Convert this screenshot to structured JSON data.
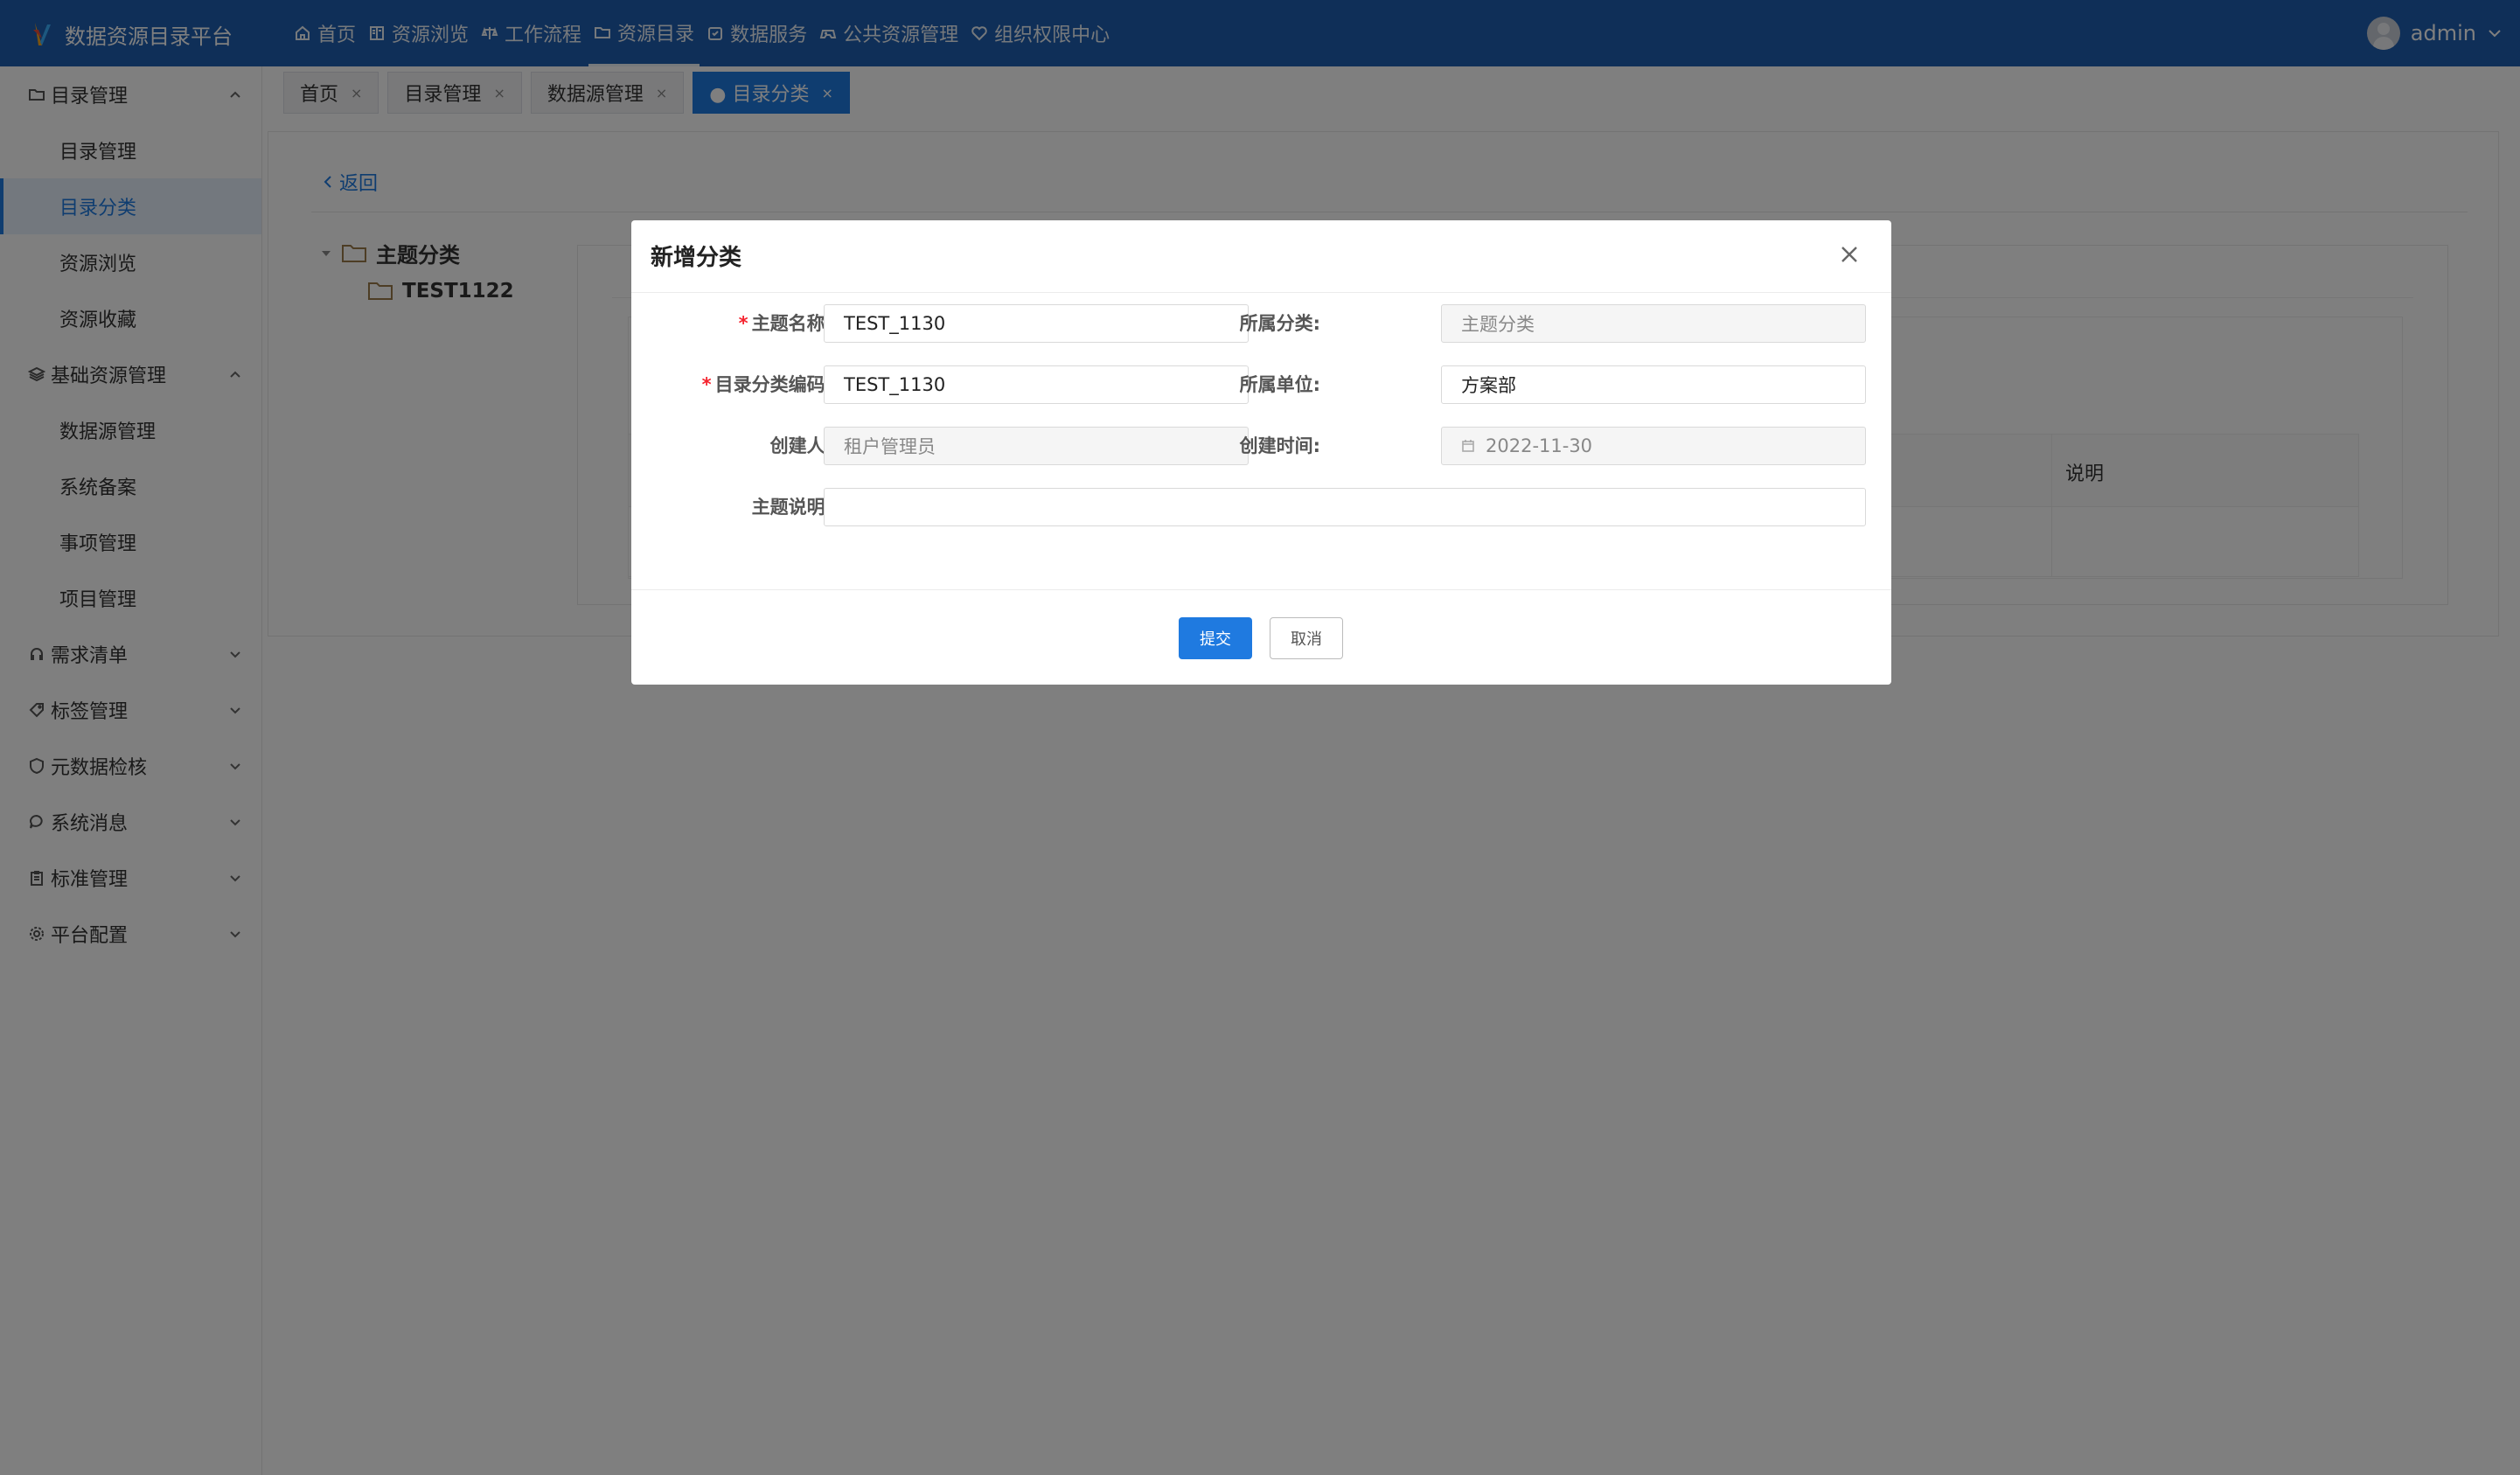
{
  "app": {
    "title": "数据资源目录平台"
  },
  "nav": [
    {
      "label": "首页",
      "icon": "home-icon"
    },
    {
      "label": "资源浏览",
      "icon": "book-icon"
    },
    {
      "label": "工作流程",
      "icon": "workflow-icon"
    },
    {
      "label": "资源目录",
      "icon": "folder-icon",
      "active": true
    },
    {
      "label": "数据服务",
      "icon": "service-icon"
    },
    {
      "label": "公共资源管理",
      "icon": "gamepad-icon"
    },
    {
      "label": "组织权限中心",
      "icon": "heart-icon"
    }
  ],
  "user": {
    "name": "admin"
  },
  "sidebar": {
    "group1": {
      "label": "目录管理",
      "items": [
        "目录管理",
        "目录分类",
        "资源浏览",
        "资源收藏"
      ],
      "active_item": "目录分类"
    },
    "group2": {
      "label": "基础资源管理",
      "items": [
        "数据源管理",
        "系统备案",
        "事项管理",
        "项目管理"
      ]
    },
    "collapsed": [
      "需求清单",
      "标签管理",
      "元数据检核",
      "系统消息",
      "标准管理",
      "平台配置"
    ]
  },
  "tabs": [
    {
      "label": "首页"
    },
    {
      "label": "目录管理"
    },
    {
      "label": "数据源管理"
    },
    {
      "label": "● 目录分类",
      "active": true
    }
  ],
  "tab_close": "×",
  "page": {
    "back_label": "返回",
    "tree_root": "主题分类",
    "tree_child": "TEST1122",
    "table_col_desc": "说明"
  },
  "modal": {
    "title": "新增分类",
    "fields": {
      "theme_name": {
        "label": "主题名称:",
        "value": "TEST_1130",
        "required": true
      },
      "category": {
        "label": "所属分类:",
        "value": "主题分类",
        "disabled": true
      },
      "code": {
        "label": "目录分类编码:",
        "value": "TEST_1130",
        "required": true
      },
      "unit": {
        "label": "所属单位:",
        "value": "方案部"
      },
      "creator": {
        "label": "创建人:",
        "value": "租户管理员",
        "disabled": true
      },
      "created_at": {
        "label": "创建时间:",
        "value": "2022-11-30",
        "disabled": true
      },
      "description": {
        "label": "主题说明:",
        "value": ""
      }
    },
    "required_mark": "*",
    "submit_label": "提交",
    "cancel_label": "取消"
  },
  "colors": {
    "header": "#1f5eb0",
    "primary": "#1f7ae0",
    "required": "#f5222d"
  }
}
